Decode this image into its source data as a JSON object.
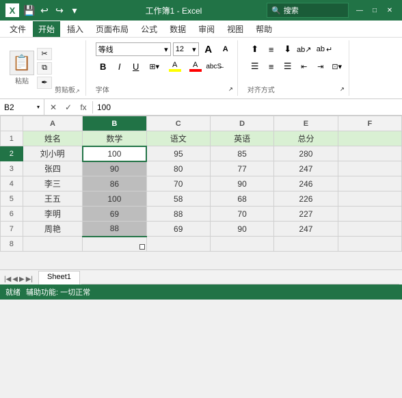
{
  "titleBar": {
    "logo": "X",
    "title": "工作簿1 - Excel",
    "searchPlaceholder": "搜索",
    "undoLabel": "↩",
    "redoLabel": "↪"
  },
  "menuBar": {
    "items": [
      "文件",
      "开始",
      "插入",
      "页面布局",
      "公式",
      "数据",
      "审阅",
      "视图",
      "帮助"
    ]
  },
  "ribbon": {
    "clipboard": {
      "paste": "粘贴",
      "cut": "✂",
      "copy": "⧉",
      "formatPainter": "✒",
      "label": "剪贴板",
      "expand": "↗"
    },
    "font": {
      "name": "等线",
      "size": "12",
      "growLabel": "A",
      "shrinkLabel": "A",
      "boldLabel": "B",
      "italicLabel": "I",
      "underlineLabel": "U",
      "borderLabel": "⊞",
      "fillLabel": "A",
      "colorLabel": "A",
      "label": "字体",
      "expand": "↗"
    },
    "align": {
      "topAlign": "⬆",
      "middleAlign": "≡",
      "bottomAlign": "⬇",
      "leftAlign": "☰",
      "centerAlign": "≡",
      "rightAlign": "☰",
      "wrap": "ab↵",
      "merge": "⊡",
      "label": "对齐方式",
      "expand": "↗"
    }
  },
  "formulaBar": {
    "nameBox": "B2",
    "cancelBtn": "✕",
    "confirmBtn": "✓",
    "funcBtn": "fx",
    "formula": "100"
  },
  "sheet": {
    "columns": [
      "A",
      "B",
      "C",
      "D",
      "E",
      "F"
    ],
    "rows": [
      {
        "rowNum": "1",
        "cells": [
          "姓名",
          "数学",
          "语文",
          "英语",
          "总分",
          ""
        ]
      },
      {
        "rowNum": "2",
        "cells": [
          "刘小明",
          "100",
          "95",
          "85",
          "280",
          ""
        ]
      },
      {
        "rowNum": "3",
        "cells": [
          "张四",
          "90",
          "80",
          "77",
          "247",
          ""
        ]
      },
      {
        "rowNum": "4",
        "cells": [
          "李三",
          "86",
          "70",
          "90",
          "246",
          ""
        ]
      },
      {
        "rowNum": "5",
        "cells": [
          "王五",
          "100",
          "58",
          "68",
          "226",
          ""
        ]
      },
      {
        "rowNum": "6",
        "cells": [
          "李明",
          "69",
          "88",
          "70",
          "227",
          ""
        ]
      },
      {
        "rowNum": "7",
        "cells": [
          "周艳",
          "88",
          "69",
          "90",
          "247",
          ""
        ]
      },
      {
        "rowNum": "8",
        "cells": [
          "",
          "",
          "",
          "",
          "",
          ""
        ]
      }
    ]
  },
  "sheetTabs": {
    "tabs": [
      "Sheet1"
    ]
  },
  "statusBar": {
    "readyLabel": "就绪",
    "accessibilityLabel": "辅助功能: 一切正常"
  }
}
